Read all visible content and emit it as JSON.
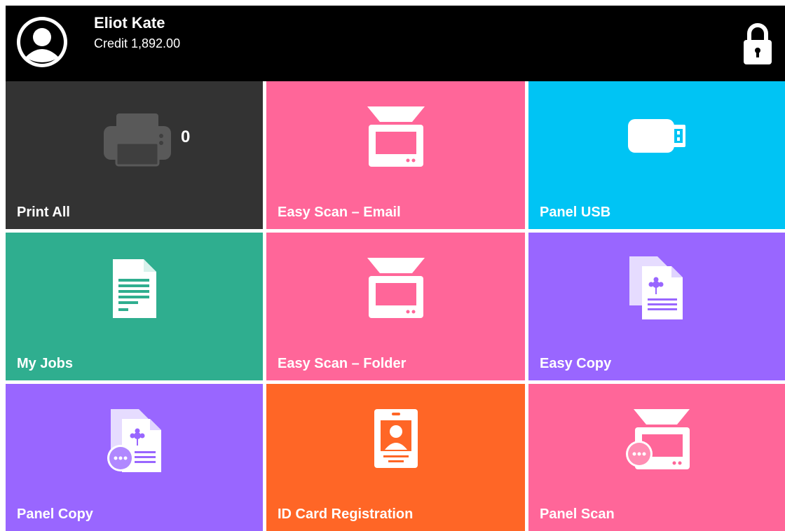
{
  "header": {
    "user_name": "Eliot Kate",
    "credit": "Credit 1,892.00",
    "avatar_icon": "user-avatar-icon",
    "lock_icon": "lock-icon"
  },
  "tiles": [
    {
      "label": "Print All",
      "icon": "printer-icon",
      "color": "#333333",
      "badge": "0"
    },
    {
      "label": "Easy Scan – Email",
      "icon": "scanner-icon",
      "color": "#FF6699"
    },
    {
      "label": "Panel USB",
      "icon": "usb-drive-icon",
      "color": "#00C4F4"
    },
    {
      "label": "My Jobs",
      "icon": "document-icon",
      "color": "#2FAE8F"
    },
    {
      "label": "Easy Scan – Folder",
      "icon": "scanner-icon",
      "color": "#FF6699"
    },
    {
      "label": "Easy Copy",
      "icon": "copy-documents-icon",
      "color": "#9966FF"
    },
    {
      "label": "Panel Copy",
      "icon": "copy-documents-more-icon",
      "color": "#9966FF"
    },
    {
      "label": "ID Card Registration",
      "icon": "id-card-icon",
      "color": "#FF6626"
    },
    {
      "label": "Panel Scan",
      "icon": "scanner-more-icon",
      "color": "#FF6699"
    }
  ]
}
